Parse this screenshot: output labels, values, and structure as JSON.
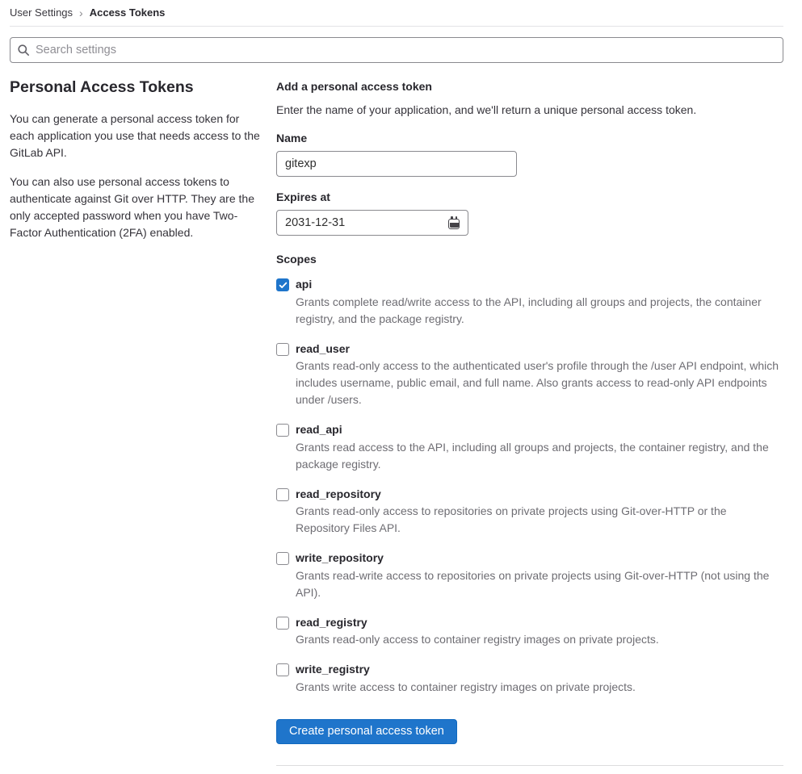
{
  "breadcrumb": {
    "parent": "User Settings",
    "separator": "›",
    "current": "Access Tokens"
  },
  "search": {
    "placeholder": "Search settings"
  },
  "sidebar": {
    "title": "Personal Access Tokens",
    "paragraphs": [
      "You can generate a personal access token for each application you use that needs access to the GitLab API.",
      "You can also use personal access tokens to authenticate against Git over HTTP. They are the only accepted password when you have Two-Factor Authentication (2FA) enabled."
    ]
  },
  "form": {
    "title": "Add a personal access token",
    "description": "Enter the name of your application, and we'll return a unique personal access token.",
    "name_label": "Name",
    "name_value": "gitexp",
    "expires_label": "Expires at",
    "expires_value": "2031-12-31",
    "scopes_label": "Scopes",
    "scopes": [
      {
        "label": "api",
        "checked": true,
        "description": "Grants complete read/write access to the API, including all groups and projects, the container registry, and the package registry."
      },
      {
        "label": "read_user",
        "checked": false,
        "description": "Grants read-only access to the authenticated user's profile through the /user API endpoint, which includes username, public email, and full name. Also grants access to read-only API endpoints under /users."
      },
      {
        "label": "read_api",
        "checked": false,
        "description": "Grants read access to the API, including all groups and projects, the container registry, and the package registry."
      },
      {
        "label": "read_repository",
        "checked": false,
        "description": "Grants read-only access to repositories on private projects using Git-over-HTTP or the Repository Files API."
      },
      {
        "label": "write_repository",
        "checked": false,
        "description": "Grants read-write access to repositories on private projects using Git-over-HTTP (not using the API)."
      },
      {
        "label": "read_registry",
        "checked": false,
        "description": "Grants read-only access to container registry images on private projects."
      },
      {
        "label": "write_registry",
        "checked": false,
        "description": "Grants write access to container registry images on private projects."
      }
    ],
    "submit_label": "Create personal access token"
  },
  "colors": {
    "accent_blue": "#1f75cb",
    "text_primary": "#303030",
    "text_secondary": "#6e6d73",
    "input_border": "#8a8a8f",
    "divider": "#dcdcde"
  }
}
